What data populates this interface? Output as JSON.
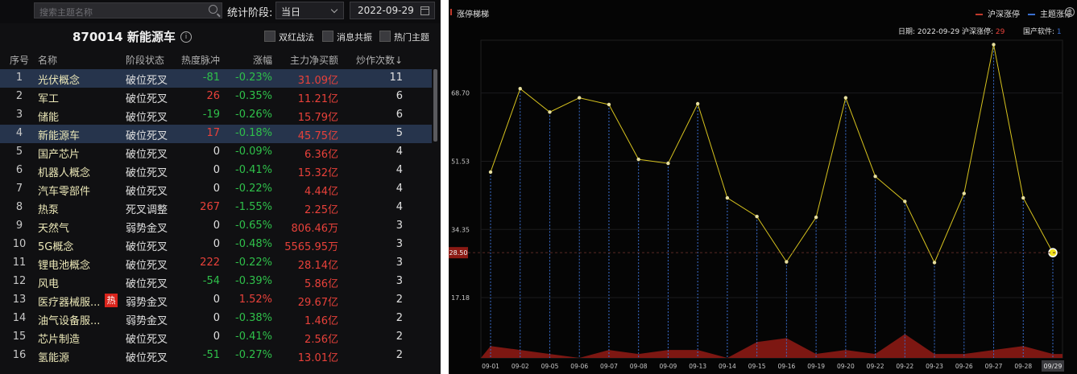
{
  "search": {
    "placeholder": "搜索主题名称"
  },
  "filter": {
    "label": "统计阶段:",
    "period": "当日",
    "date": "2022-09-29"
  },
  "header": {
    "title": "870014 新能源车",
    "info_glyph": "i",
    "options": [
      "双红战法",
      "消息共振",
      "热门主题"
    ]
  },
  "table": {
    "columns": [
      "序号",
      "名称",
      "阶段状态",
      "热度脉冲",
      "涨幅",
      "主力净买额",
      "炒作次数↓"
    ],
    "rows": [
      {
        "no": "1",
        "name": "光伏概念",
        "state": "破位死叉",
        "pulse": "-81",
        "change": "-0.23%",
        "net": "31.09亿",
        "count": "11",
        "hot": ""
      },
      {
        "no": "2",
        "name": "军工",
        "state": "破位死叉",
        "pulse": "26",
        "change": "-0.35%",
        "net": "11.21亿",
        "count": "6",
        "hot": ""
      },
      {
        "no": "3",
        "name": "储能",
        "state": "破位死叉",
        "pulse": "-19",
        "change": "-0.26%",
        "net": "15.79亿",
        "count": "6",
        "hot": ""
      },
      {
        "no": "4",
        "name": "新能源车",
        "state": "破位死叉",
        "pulse": "17",
        "change": "-0.18%",
        "net": "45.75亿",
        "count": "5",
        "hot": ""
      },
      {
        "no": "5",
        "name": "国产芯片",
        "state": "破位死叉",
        "pulse": "0",
        "change": "-0.09%",
        "net": "6.36亿",
        "count": "4",
        "hot": ""
      },
      {
        "no": "6",
        "name": "机器人概念",
        "state": "破位死叉",
        "pulse": "0",
        "change": "-0.41%",
        "net": "15.32亿",
        "count": "4",
        "hot": ""
      },
      {
        "no": "7",
        "name": "汽车零部件",
        "state": "破位死叉",
        "pulse": "0",
        "change": "-0.22%",
        "net": "4.44亿",
        "count": "4",
        "hot": ""
      },
      {
        "no": "8",
        "name": "热泵",
        "state": "死叉调整",
        "pulse": "267",
        "change": "-1.55%",
        "net": "2.25亿",
        "count": "4",
        "hot": ""
      },
      {
        "no": "9",
        "name": "天然气",
        "state": "弱势金叉",
        "pulse": "0",
        "change": "-0.65%",
        "net": "806.46万",
        "count": "3",
        "hot": ""
      },
      {
        "no": "10",
        "name": "5G概念",
        "state": "破位死叉",
        "pulse": "0",
        "change": "-0.48%",
        "net": "5565.95万",
        "count": "3",
        "hot": ""
      },
      {
        "no": "11",
        "name": "锂电池概念",
        "state": "破位死叉",
        "pulse": "222",
        "change": "-0.22%",
        "net": "28.14亿",
        "count": "3",
        "hot": ""
      },
      {
        "no": "12",
        "name": "风电",
        "state": "破位死叉",
        "pulse": "-54",
        "change": "-0.39%",
        "net": "5.86亿",
        "count": "3",
        "hot": ""
      },
      {
        "no": "13",
        "name": "医疗器械服...",
        "state": "弱势金叉",
        "pulse": "0",
        "change": "1.52%",
        "net": "29.67亿",
        "count": "2",
        "hot": "热"
      },
      {
        "no": "14",
        "name": "油气设备服...",
        "state": "弱势金叉",
        "pulse": "0",
        "change": "-0.38%",
        "net": "1.46亿",
        "count": "2",
        "hot": ""
      },
      {
        "no": "15",
        "name": "芯片制造",
        "state": "破位死叉",
        "pulse": "0",
        "change": "-0.41%",
        "net": "2.56亿",
        "count": "2",
        "hot": ""
      },
      {
        "no": "16",
        "name": "氢能源",
        "state": "破位死叉",
        "pulse": "-51",
        "change": "-0.27%",
        "net": "13.01亿",
        "count": "2",
        "hot": ""
      }
    ]
  },
  "colors": {
    "up": "#e8413a",
    "down": "#2fc04a",
    "neutral": "#e0e0e0",
    "line": "#d6c21e",
    "bar": "#8b1a14",
    "guide": "#3a6fd0"
  },
  "chart_panel": {
    "title": "涨停梯梯",
    "legend": [
      {
        "label": "沪深涨停",
        "color": "#c0392b"
      },
      {
        "label": "主题涨停",
        "color": "#3a6fd0"
      }
    ],
    "info_glyph": "?",
    "info": {
      "date_label": "日期:",
      "date": "2022-09-29",
      "hs_label": "沪深涨停:",
      "hs_value": "29",
      "gn_label": "国产软件:",
      "gn_value": "1"
    },
    "current_tag": "28.50",
    "last_tick": "09/29"
  },
  "chart_data": {
    "type": "line",
    "x": [
      "09-01",
      "09-02",
      "09-05",
      "09-06",
      "09-07",
      "09-08",
      "09-09",
      "09-13",
      "09-14",
      "09-15",
      "09-16",
      "09-19",
      "09-20",
      "09-22",
      "09-22",
      "09-23",
      "09-26",
      "09-27",
      "09-28",
      "09/29"
    ],
    "y_ticks": [
      17.18,
      34.35,
      51.53,
      68.7
    ],
    "ylim": [
      2,
      82
    ],
    "series": [
      {
        "values": [
          48.8,
          69.8,
          63.9,
          67.5,
          65.8,
          52.0,
          51.0,
          66.0,
          42.3,
          37.6,
          26.2,
          37.4,
          67.5,
          47.7,
          41.4,
          26.0,
          43.4,
          80.9,
          42.3,
          28.5
        ]
      },
      {
        "values": [
          5,
          4,
          3,
          2,
          4,
          3,
          4,
          4,
          2,
          6,
          7,
          3,
          4,
          3,
          8,
          3,
          3,
          4,
          5,
          3
        ]
      }
    ]
  }
}
